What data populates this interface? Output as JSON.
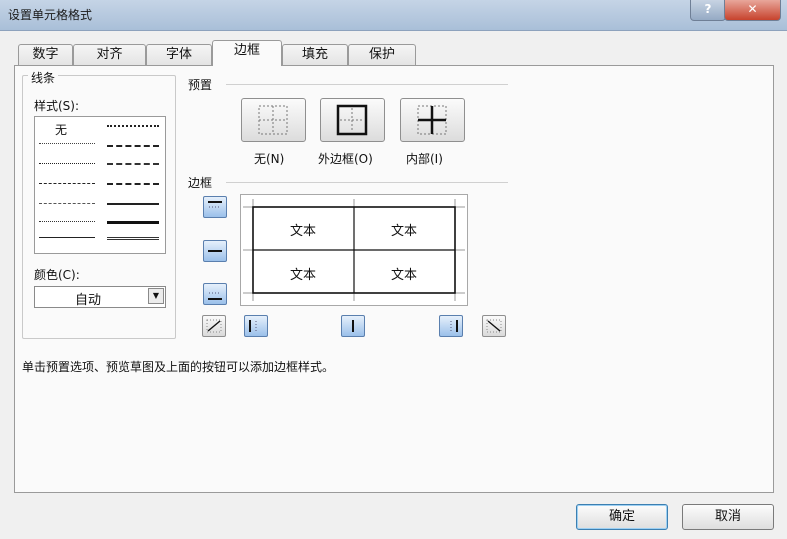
{
  "window": {
    "title": "设置单元格格式",
    "help": "?",
    "close": "✕"
  },
  "tabs": [
    {
      "label": "数字"
    },
    {
      "label": "对齐"
    },
    {
      "label": "字体"
    },
    {
      "label": "边框"
    },
    {
      "label": "填充"
    },
    {
      "label": "保护"
    }
  ],
  "line": {
    "group_title": "线条",
    "style_label": "样式(S):",
    "style_none": "无",
    "color_label": "颜色(C):",
    "color_value": "自动"
  },
  "preset": {
    "title": "预置",
    "none_label": "无(N)",
    "outline_label": "外边框(O)",
    "inside_label": "内部(I)"
  },
  "border": {
    "title": "边框",
    "preview_cells": [
      "文本",
      "文本",
      "文本",
      "文本"
    ]
  },
  "hint": "单击预置选项、预览草图及上面的按钮可以添加边框样式。",
  "buttons": {
    "ok": "确定",
    "cancel": "取消"
  },
  "icons": {
    "help": "help-icon",
    "close": "close-icon",
    "dropdown": "chevron-down-icon",
    "preset_none": "border-none-icon",
    "preset_outline": "border-outline-icon",
    "preset_inside": "border-inside-icon",
    "border_top": "border-top-icon",
    "border_middle_h": "border-inside-horizontal-icon",
    "border_bottom": "border-bottom-icon",
    "border_diag_up": "border-diagonal-up-icon",
    "border_left": "border-left-icon",
    "border_middle_v": "border-inside-vertical-icon",
    "border_right": "border-right-icon",
    "border_diag_down": "border-diagonal-down-icon"
  },
  "colors": {
    "accent": "#3c7fb1",
    "button_blue": "#9bc0ea",
    "panel": "#fafafa"
  }
}
